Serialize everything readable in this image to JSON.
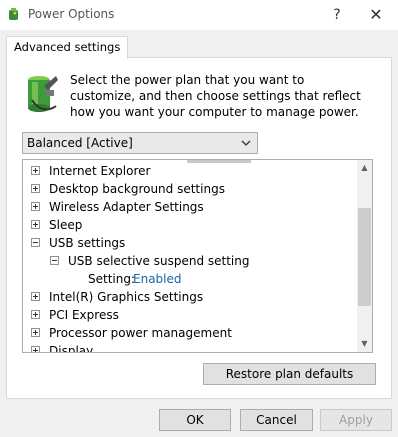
{
  "window": {
    "title": "Power Options",
    "help_glyph": "?",
    "close_glyph": "✕"
  },
  "tabs": [
    {
      "label": "Advanced settings"
    }
  ],
  "instruction": "Select the power plan that you want to customize, and then choose settings that reflect how you want your computer to manage power.",
  "plan_select": {
    "value": "Balanced [Active]"
  },
  "tree": {
    "items": [
      {
        "label": "Internet Explorer",
        "expanded": false
      },
      {
        "label": "Desktop background settings",
        "expanded": false
      },
      {
        "label": "Wireless Adapter Settings",
        "expanded": false
      },
      {
        "label": "Sleep",
        "expanded": false
      },
      {
        "label": "USB settings",
        "expanded": true
      },
      {
        "label": "USB selective suspend setting",
        "expanded": true
      },
      {
        "label": "Setting:",
        "value": "Enabled"
      },
      {
        "label": "Intel(R) Graphics Settings",
        "expanded": false
      },
      {
        "label": "PCI Express",
        "expanded": false
      },
      {
        "label": "Processor power management",
        "expanded": false
      },
      {
        "label": "Display",
        "expanded": false
      }
    ]
  },
  "buttons": {
    "restore": "Restore plan defaults",
    "ok": "OK",
    "cancel": "Cancel",
    "apply": "Apply"
  },
  "icons": {
    "app": "power-options-icon",
    "plan": "battery-plug-icon",
    "chevron": "chevron-down-icon"
  },
  "colors": {
    "link": "#1a63a8",
    "disabled_text": "#a0a0a0"
  }
}
